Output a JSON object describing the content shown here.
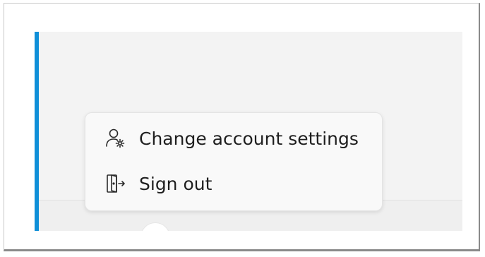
{
  "menu": {
    "items": [
      {
        "label": "Change account settings",
        "icon": "person-gear-icon"
      },
      {
        "label": "Sign out",
        "icon": "sign-out-icon"
      }
    ]
  },
  "colors": {
    "accent": "#0f8fd8",
    "window_background": "#f3f3f3",
    "menu_background": "#f9f9f9",
    "text": "#1f1f1f"
  }
}
